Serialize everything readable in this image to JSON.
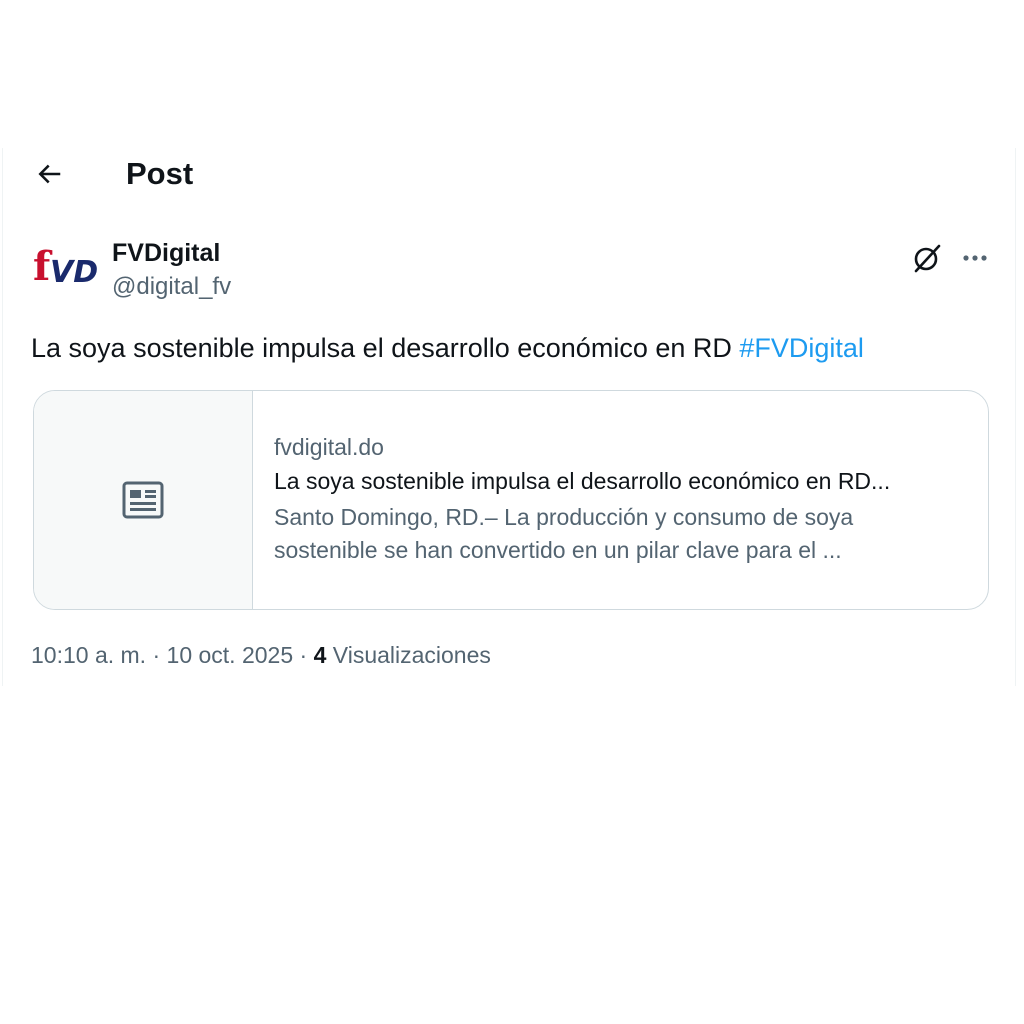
{
  "header": {
    "back_icon": "arrow-left-icon",
    "title": "Post"
  },
  "author": {
    "avatar_icon": "fvd-logo-icon",
    "avatar_logo_text": "fVD",
    "name": "FVDigital",
    "handle": "@digital_fv"
  },
  "actions": {
    "grok_icon": "grok-icon",
    "more_icon": "more-horizontal-icon"
  },
  "post": {
    "text": "La soya sostenible impulsa el desarrollo económico en RD ",
    "hashtag": "#FVDigital"
  },
  "link_card": {
    "media_icon": "article-icon",
    "domain": "fvdigital.do",
    "title": "La soya sostenible impulsa el desarrollo económico en RD...",
    "description_line1": "Santo Domingo, RD.– La producción y consumo de soya",
    "description_line2": "sostenible se han convertido en un pilar clave para el ..."
  },
  "meta": {
    "time": "10:10 a. m.",
    "separator": " · ",
    "date": "10 oct. 2025",
    "views_count": "4",
    "views_label": " Visualizaciones"
  },
  "colors": {
    "text_primary": "#0f1419",
    "text_secondary": "#536471",
    "accent": "#1d9bf0",
    "border": "#cfd9de",
    "logo_red": "#c8102e",
    "logo_navy": "#1a2a6c"
  }
}
